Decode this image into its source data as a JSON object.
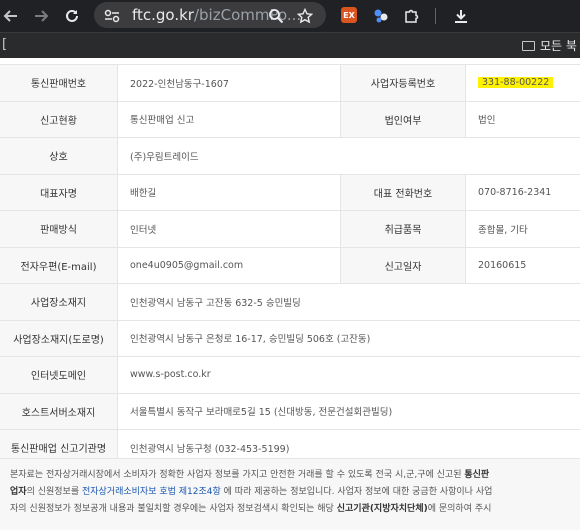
{
  "browser": {
    "url_host": "ftc.go.kr",
    "url_path": "/bizCommPo...",
    "extension_label": "EX",
    "bookmark_folder": "모든 북",
    "bookmark_left_glyph": "["
  },
  "rows": [
    {
      "label": "통신판매번호",
      "value": "2022-인천남동구-1607",
      "label2": "사업자등록번호",
      "value2": "331-88-00222"
    },
    {
      "label": "신고현황",
      "value": "통신판매업 신고",
      "label2": "법인여부",
      "value2": "법인"
    },
    {
      "label": "상호",
      "value": "(주)우림트레이드"
    },
    {
      "label": "대표자명",
      "value": "배한길",
      "label2": "대표 전화번호",
      "value2": "070-8716-2341"
    },
    {
      "label": "판매방식",
      "value": "인터넷",
      "label2": "취급품목",
      "value2": "종합몰, 기타"
    },
    {
      "label": "전자우편(E-mail)",
      "value": "one4u0905@gmail.com",
      "label2": "신고일자",
      "value2": "20160615"
    },
    {
      "label": "사업장소재지",
      "value": "인천광역시 남동구 고잔동 632-5 승민빌딩"
    },
    {
      "label": "사업장소재지(도로명)",
      "value": "인천광역시 남동구 은청로 16-17, 승민빌딩 506호 (고잔동)"
    },
    {
      "label": "인터넷도메인",
      "value": "www.s-post.co.kr"
    },
    {
      "label": "호스트서버소재지",
      "value": "서울특별시 동작구 보라매로5길 15 (신대방동, 전문건설회관빌딩)"
    },
    {
      "label": "통신판매업 신고기관명",
      "value": "인천광역시 남동구청  (032-453-5199)"
    }
  ],
  "notice": {
    "l1_a": "본자료는 전자상거래시장에서 소비자가 정확한 사업자 정보를 가지고 안전한 거래를 할 수 있도록 전국 시,군,구에 신고된 ",
    "l1_b": "통신판",
    "l2_a": "업자",
    "l2_b": "의 신원정보를 ",
    "l2_link": "전자상거래소비자보 호법 제12조4항",
    "l2_c": " 에 따라 제공하는 정보입니다. 사업자 정보에 대한 궁금한 사항이나 사업",
    "l3_a": "자의 신원정보가 정보공개 내용과 불일치할 경우에는 사업자 정보검색시 확인되는 해당 ",
    "l3_b": "신고기관(지방자치단체)",
    "l3_c": "에 문의하여 주시"
  }
}
